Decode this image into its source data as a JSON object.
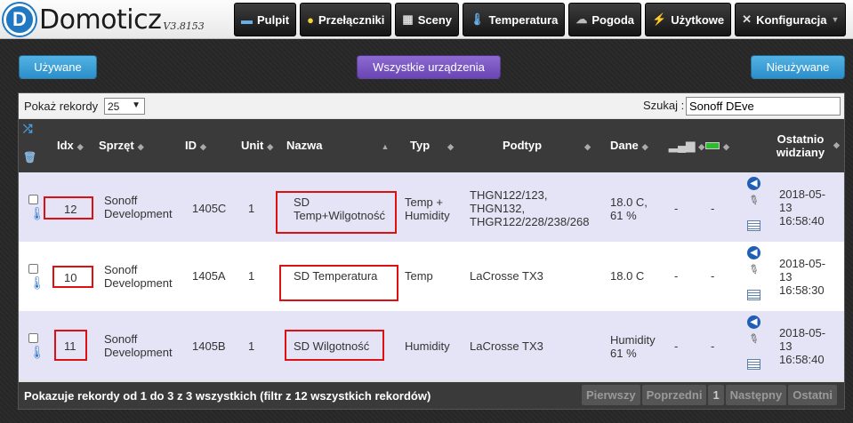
{
  "app": {
    "logo_letter": "D",
    "name": "Domoticz",
    "version": "V3.8153"
  },
  "nav": [
    {
      "label": "Pulpit",
      "icon": "monitor-icon"
    },
    {
      "label": "Przełączniki",
      "icon": "bulb-icon"
    },
    {
      "label": "Sceny",
      "icon": "scenes-icon"
    },
    {
      "label": "Temperatura",
      "icon": "thermometer-icon"
    },
    {
      "label": "Pogoda",
      "icon": "weather-icon"
    },
    {
      "label": "Użytkowe",
      "icon": "utility-icon"
    },
    {
      "label": "Konfiguracja",
      "icon": "tools-icon"
    }
  ],
  "filters": {
    "used": "Używane",
    "all": "Wszystkie urządzenia",
    "unused": "Nieużywane"
  },
  "table_controls": {
    "show_label": "Pokaż rekordy",
    "page_size": "25",
    "search_label": "Szukaj :",
    "search_value": "Sonoff DEve"
  },
  "columns": {
    "idx": "Idx",
    "hardware": "Sprzęt",
    "id": "ID",
    "unit": "Unit",
    "name": "Nazwa",
    "type": "Typ",
    "subtype": "Podtyp",
    "data": "Dane",
    "last_seen_1": "Ostatnio",
    "last_seen_2": "widziany"
  },
  "rows": [
    {
      "idx": "12",
      "hardware_1": "Sonoff",
      "hardware_2": "Development",
      "id": "1405C",
      "unit": "1",
      "name_1": "SD",
      "name_2": "Temp+Wilgotność",
      "type_1": "Temp +",
      "type_2": "Humidity",
      "subtype_1": "THGN122/123,",
      "subtype_2": "THGN132,",
      "subtype_3": "THGR122/228/238/268",
      "data_1": "18.0 C,",
      "data_2": "61 %",
      "sig": "-",
      "bat": "-",
      "seen_1": "2018-05-",
      "seen_2": "13",
      "seen_3": "16:58:40"
    },
    {
      "idx": "10",
      "hardware_1": "Sonoff",
      "hardware_2": "Development",
      "id": "1405A",
      "unit": "1",
      "name_1": "SD Temperatura",
      "name_2": "",
      "type_1": "Temp",
      "type_2": "",
      "subtype_1": "LaCrosse TX3",
      "subtype_2": "",
      "subtype_3": "",
      "data_1": "18.0 C",
      "data_2": "",
      "sig": "-",
      "bat": "-",
      "seen_1": "2018-05-",
      "seen_2": "13",
      "seen_3": "16:58:30"
    },
    {
      "idx": "11",
      "hardware_1": "Sonoff",
      "hardware_2": "Development",
      "id": "1405B",
      "unit": "1",
      "name_1": "SD Wilgotność",
      "name_2": "",
      "type_1": "Humidity",
      "type_2": "",
      "subtype_1": "LaCrosse TX3",
      "subtype_2": "",
      "subtype_3": "",
      "data_1": "Humidity",
      "data_2": "61 %",
      "sig": "-",
      "bat": "-",
      "seen_1": "2018-05-",
      "seen_2": "13",
      "seen_3": "16:58:40"
    }
  ],
  "footer": {
    "info": "Pokazuje rekordy od 1 do 3 z 3 wszystkich (filtr z 12 wszystkich rekordów)",
    "first": "Pierwszy",
    "prev": "Poprzedni",
    "page": "1",
    "next": "Następny",
    "last": "Ostatni"
  },
  "colors": {
    "nav_bg": "#1a1a1a",
    "row_odd": "#e4e4f6",
    "row_even": "#ffffff",
    "highlight": "#dd1111",
    "accent_blue": "#2c8ecb",
    "accent_purple": "#6a45b4"
  }
}
